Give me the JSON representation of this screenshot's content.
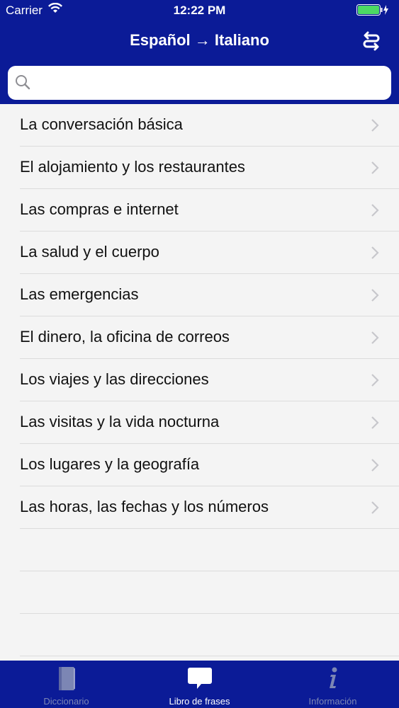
{
  "status_bar": {
    "carrier": "Carrier",
    "time": "12:22 PM"
  },
  "navbar": {
    "title": "Español → Italiano",
    "swap_icon": "swap-arrows-icon"
  },
  "search": {
    "placeholder": "",
    "value": ""
  },
  "categories": [
    {
      "label": "La conversación básica"
    },
    {
      "label": "El alojamiento y los restaurantes"
    },
    {
      "label": "Las compras e internet"
    },
    {
      "label": "La salud y el cuerpo"
    },
    {
      "label": "Las emergencias"
    },
    {
      "label": "El dinero, la oficina de correos"
    },
    {
      "label": "Los viajes y las direcciones"
    },
    {
      "label": "Las visitas y la vida nocturna"
    },
    {
      "label": "Los lugares y la geografía"
    },
    {
      "label": "Las horas, las fechas y los números"
    }
  ],
  "tabbar": {
    "tabs": [
      {
        "label": "Diccionario",
        "icon": "book-icon",
        "active": false
      },
      {
        "label": "Libro de frases",
        "icon": "speech-bubble-icon",
        "active": true
      },
      {
        "label": "Información",
        "icon": "info-icon",
        "active": false
      }
    ]
  },
  "colors": {
    "header_bg": "#0b1b97",
    "list_bg": "#f4f4f4",
    "battery": "#4cd964"
  }
}
